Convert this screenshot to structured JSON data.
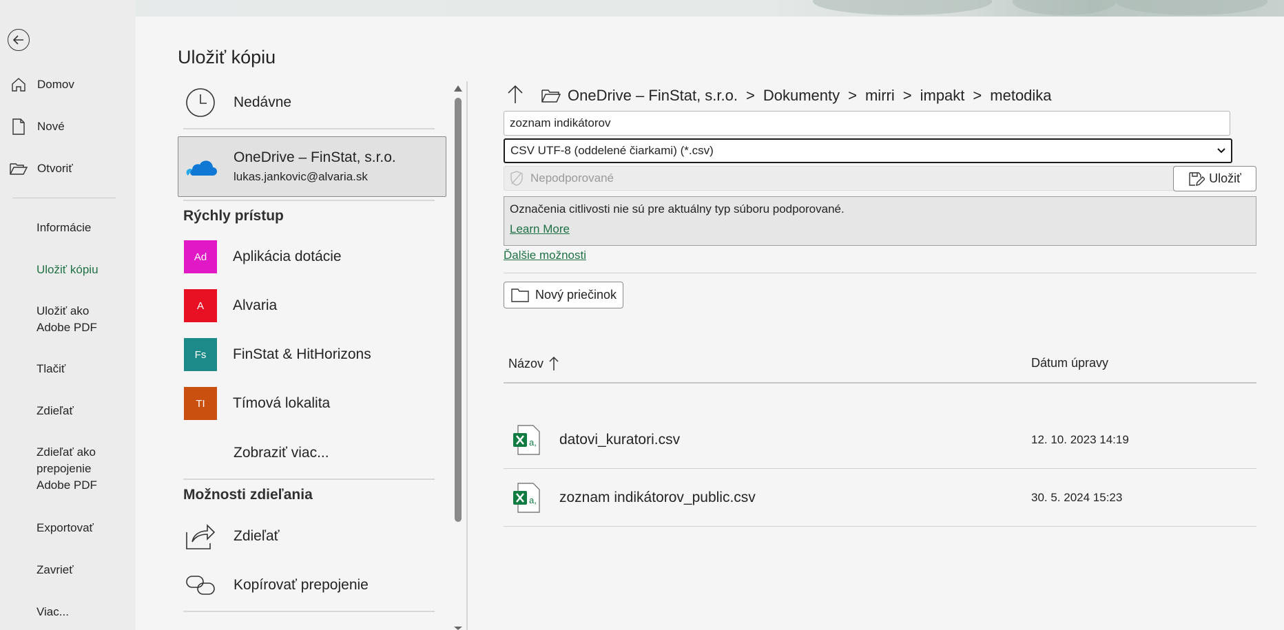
{
  "page_title": "Uložiť kópiu",
  "leftnav": {
    "top_items": [
      {
        "label": "Domov",
        "icon": "home-icon"
      },
      {
        "label": "Nové",
        "icon": "new-document-icon"
      },
      {
        "label": "Otvoriť",
        "icon": "open-folder-icon"
      }
    ],
    "items": [
      "Informácie",
      "Uložiť kópiu",
      "Uložiť ako Adobe PDF",
      "Tlačiť",
      "Zdieľať",
      "Zdieľať ako prepojenie Adobe PDF",
      "Exportovať",
      "Zavrieť",
      "Viac..."
    ],
    "active_index": 1
  },
  "locations": {
    "recent": "Nedávne",
    "onedrive_name": "OneDrive – FinStat, s.r.o.",
    "onedrive_account": "lukas.jankovic@alvaria.sk",
    "quick_access_head": "Rýchly prístup",
    "quick_access": [
      {
        "abbr": "Ad",
        "label": "Aplikácia dotácie",
        "color": "#e018c6"
      },
      {
        "abbr": "A",
        "label": "Alvaria",
        "color": "#e81123"
      },
      {
        "abbr": "Fs",
        "label": "FinStat & HitHorizons",
        "color": "#1d8a8a"
      },
      {
        "abbr": "TI",
        "label": "Tímová lokalita",
        "color": "#ca5010"
      }
    ],
    "show_more": "Zobraziť viac...",
    "sharing_head": "Možnosti zdieľania",
    "share": "Zdieľať",
    "copy_link": "Kopírovať prepojenie"
  },
  "breadcrumb": [
    "OneDrive – FinStat, s.r.o.",
    "Dokumenty",
    "mirri",
    "impakt",
    "metodika"
  ],
  "breadcrumb_sep": ">",
  "filename": "zoznam indikátorov",
  "filetype": "CSV UTF-8 (oddelené čiarkami) (*.csv)",
  "sensitivity": "Nepodporované",
  "save_label": "Uložiť",
  "notice_text": "Označenia citlivosti nie sú pre aktuálny typ súboru podporované.",
  "learn_more": "Learn More",
  "more_options": "Ďalšie možnosti",
  "new_folder": "Nový priečinok",
  "columns": {
    "name": "Názov",
    "date": "Dátum úpravy"
  },
  "files": [
    {
      "name": "datovi_kuratori.csv",
      "date": "12. 10. 2023 14:19"
    },
    {
      "name": "zoznam indikátorov_public.csv",
      "date": "30. 5. 2024 15:23"
    }
  ],
  "colors": {
    "accent": "#1e7145",
    "excel": "#107c41"
  }
}
